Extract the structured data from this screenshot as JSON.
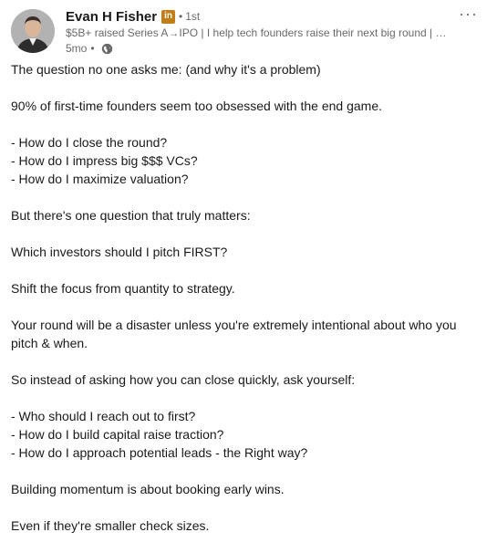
{
  "author": {
    "name": "Evan H Fisher",
    "badge": "in",
    "degree": "1st",
    "headline": "$5B+ raised Series A→IPO | I help tech founders raise their next big round | a1...",
    "time": "5mo",
    "visibility_icon": "globe-icon"
  },
  "menu": {
    "more_label": "···"
  },
  "post": {
    "p1": "The question no one asks me: (and why it's a problem)",
    "p2": "90% of first-time founders seem too obsessed with the end game.",
    "list1": [
      "- How do I close the round?",
      "- How do I impress big $$$ VCs?",
      "- How do I maximize valuation?"
    ],
    "p3": "But there's one question that truly matters:",
    "p4": "Which investors should I pitch FIRST?",
    "p5": "Shift the focus from quantity to strategy.",
    "p6": "Your round will be a disaster unless you're extremely intentional about who you pitch & when.",
    "p7": "So instead of asking how you can close quickly, ask yourself:",
    "list2": [
      "- Who should I reach out to first?",
      "- How do I build capital raise traction?",
      "- How do I approach potential leads - the Right way?"
    ],
    "p8": "Building momentum is about booking early wins.",
    "p9": "Even if they're smaller check sizes."
  },
  "colors": {
    "badge": "#c37d16",
    "text": "#000000e6",
    "muted": "#00000099"
  }
}
